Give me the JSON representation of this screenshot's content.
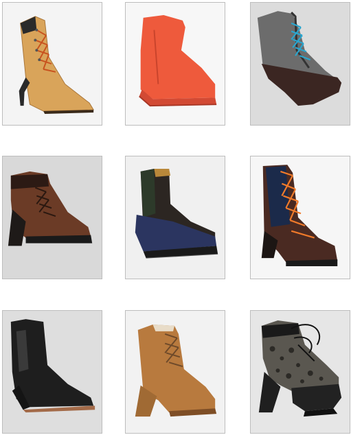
{
  "gallery": {
    "rows": 3,
    "columns": 3,
    "items": [
      {
        "icon": "tan-stiletto-lace-up-boot-icon"
      },
      {
        "icon": "orange-suede-wedge-bootie-icon"
      },
      {
        "icon": "silver-platform-lace-up-bootie-icon"
      },
      {
        "icon": "brown-suede-heeled-bootie-icon"
      },
      {
        "icon": "navy-leather-platform-chelsea-boot-icon"
      },
      {
        "icon": "brown-hiker-heeled-boot-icon"
      },
      {
        "icon": "black-suede-wedge-chelsea-boot-icon"
      },
      {
        "icon": "camel-suede-lace-up-bootie-icon"
      },
      {
        "icon": "leopard-calf-hair-platform-bootie-icon"
      }
    ]
  },
  "colors": {
    "tile_border": "#bdbdbd",
    "page_background": "#ffffff"
  }
}
